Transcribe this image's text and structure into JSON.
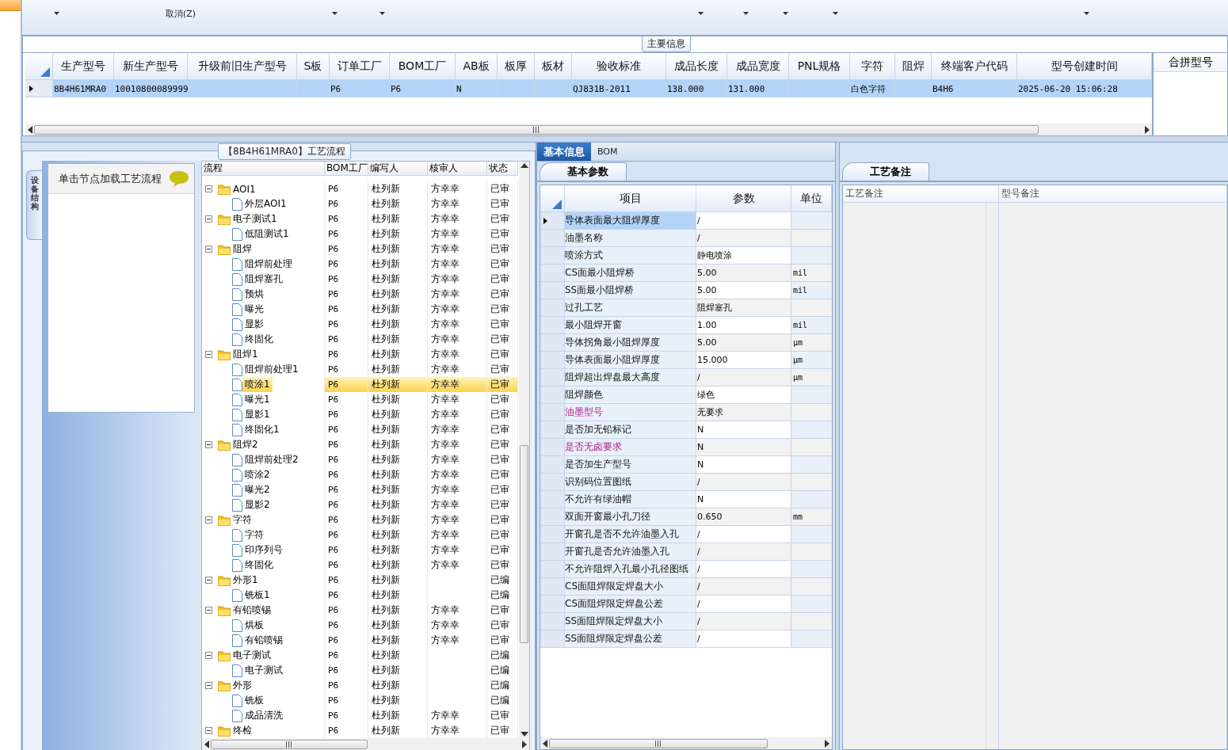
{
  "ribbon": {
    "buttons": [
      "取消(Z)"
    ]
  },
  "main_info": {
    "title": "主要信息",
    "columns": [
      "生产型号",
      "新生产型号",
      "升级前旧生产型号",
      "S板",
      "订单工厂",
      "BOM工厂",
      "AB板",
      "板厚",
      "板材",
      "验收标准",
      "成品长度",
      "成品宽度",
      "PNL规格",
      "字符",
      "阻焊",
      "终端客户代码",
      "型号创建时间"
    ],
    "rows": [
      {
        "selected": true,
        "cells": [
          "8B4H61MRA0",
          "10010800089999",
          null,
          null,
          "P6",
          "P6",
          "N",
          null,
          null,
          "QJ831B-2011",
          "138.000",
          "131.000",
          null,
          "白色字符",
          null,
          "B4H6",
          "2025-06-20 15:06:28"
        ]
      }
    ],
    "side_column": "合拼型号"
  },
  "flow": {
    "title": "【8B4H61MRA0】工艺流程",
    "side_tab": "设备结构",
    "hint": "单击节点加载工艺流程",
    "columns": [
      "流程",
      "BOM工厂",
      "编写人",
      "核审人",
      "状态"
    ],
    "nodes": [
      {
        "kind": "folder",
        "expanded": true,
        "name": "AOI1",
        "factory": "P6",
        "writer": "杜列新",
        "reviewer": "方幸幸",
        "status": "已审",
        "selected": false,
        "children": [
          {
            "kind": "file",
            "name": "外层AOI1",
            "factory": "P6",
            "writer": "杜列新",
            "reviewer": "方幸幸",
            "status": "已审",
            "selected": false
          }
        ]
      },
      {
        "kind": "folder",
        "expanded": true,
        "name": "电子测试1",
        "factory": "P6",
        "writer": "杜列新",
        "reviewer": "方幸幸",
        "status": "已审",
        "selected": false,
        "children": [
          {
            "kind": "file",
            "name": "低阻测试1",
            "factory": "P6",
            "writer": "杜列新",
            "reviewer": "方幸幸",
            "status": "已审",
            "selected": false
          }
        ]
      },
      {
        "kind": "folder",
        "expanded": true,
        "name": "阻焊",
        "factory": "P6",
        "writer": "杜列新",
        "reviewer": "方幸幸",
        "status": "已审",
        "selected": false,
        "children": [
          {
            "kind": "file",
            "name": "阻焊前处理",
            "factory": "P6",
            "writer": "杜列新",
            "reviewer": "方幸幸",
            "status": "已审",
            "selected": false
          },
          {
            "kind": "file",
            "name": "阻焊塞孔",
            "factory": "P6",
            "writer": "杜列新",
            "reviewer": "方幸幸",
            "status": "已审",
            "selected": false
          },
          {
            "kind": "file",
            "name": "预烘",
            "factory": "P6",
            "writer": "杜列新",
            "reviewer": "方幸幸",
            "status": "已审",
            "selected": false
          },
          {
            "kind": "file",
            "name": "曝光",
            "factory": "P6",
            "writer": "杜列新",
            "reviewer": "方幸幸",
            "status": "已审",
            "selected": false
          },
          {
            "kind": "file",
            "name": "显影",
            "factory": "P6",
            "writer": "杜列新",
            "reviewer": "方幸幸",
            "status": "已审",
            "selected": false
          },
          {
            "kind": "file",
            "name": "终固化",
            "factory": "P6",
            "writer": "杜列新",
            "reviewer": "方幸幸",
            "status": "已审",
            "selected": false
          }
        ]
      },
      {
        "kind": "folder",
        "expanded": true,
        "name": "阻焊1",
        "factory": "P6",
        "writer": "杜列新",
        "reviewer": "方幸幸",
        "status": "已审",
        "selected": false,
        "children": [
          {
            "kind": "file",
            "name": "阻焊前处理1",
            "factory": "P6",
            "writer": "杜列新",
            "reviewer": "方幸幸",
            "status": "已审",
            "selected": false
          },
          {
            "kind": "file",
            "name": "喷涂1",
            "factory": "P6",
            "writer": "杜列新",
            "reviewer": "方幸幸",
            "status": "已审",
            "selected": true
          },
          {
            "kind": "file",
            "name": "曝光1",
            "factory": "P6",
            "writer": "杜列新",
            "reviewer": "方幸幸",
            "status": "已审",
            "selected": false
          },
          {
            "kind": "file",
            "name": "显影1",
            "factory": "P6",
            "writer": "杜列新",
            "reviewer": "方幸幸",
            "status": "已审",
            "selected": false
          },
          {
            "kind": "file",
            "name": "终固化1",
            "factory": "P6",
            "writer": "杜列新",
            "reviewer": "方幸幸",
            "status": "已审",
            "selected": false
          }
        ]
      },
      {
        "kind": "folder",
        "expanded": true,
        "name": "阻焊2",
        "factory": "P6",
        "writer": "杜列新",
        "reviewer": "方幸幸",
        "status": "已审",
        "selected": false,
        "children": [
          {
            "kind": "file",
            "name": "阻焊前处理2",
            "factory": "P6",
            "writer": "杜列新",
            "reviewer": "方幸幸",
            "status": "已审",
            "selected": false
          },
          {
            "kind": "file",
            "name": "喷涂2",
            "factory": "P6",
            "writer": "杜列新",
            "reviewer": "方幸幸",
            "status": "已审",
            "selected": false
          },
          {
            "kind": "file",
            "name": "曝光2",
            "factory": "P6",
            "writer": "杜列新",
            "reviewer": "方幸幸",
            "status": "已审",
            "selected": false
          },
          {
            "kind": "file",
            "name": "显影2",
            "factory": "P6",
            "writer": "杜列新",
            "reviewer": "方幸幸",
            "status": "已审",
            "selected": false
          }
        ]
      },
      {
        "kind": "folder",
        "expanded": true,
        "name": "字符",
        "factory": "P6",
        "writer": "杜列新",
        "reviewer": "方幸幸",
        "status": "已审",
        "selected": false,
        "children": [
          {
            "kind": "file",
            "name": "字符",
            "factory": "P6",
            "writer": "杜列新",
            "reviewer": "方幸幸",
            "status": "已审",
            "selected": false
          },
          {
            "kind": "file",
            "name": "印序列号",
            "factory": "P6",
            "writer": "杜列新",
            "reviewer": "方幸幸",
            "status": "已审",
            "selected": false
          },
          {
            "kind": "file",
            "name": "终固化",
            "factory": "P6",
            "writer": "杜列新",
            "reviewer": "方幸幸",
            "status": "已审",
            "selected": false
          }
        ]
      },
      {
        "kind": "folder",
        "expanded": true,
        "name": "外形1",
        "factory": "P6",
        "writer": "杜列新",
        "status": "已编",
        "selected": false,
        "children": [
          {
            "kind": "file",
            "name": "铣板1",
            "factory": "P6",
            "writer": "杜列新",
            "status": "已编",
            "selected": false
          }
        ]
      },
      {
        "kind": "folder",
        "expanded": true,
        "name": "有铅喷锡",
        "factory": "P6",
        "writer": "杜列新",
        "reviewer": "方幸幸",
        "status": "已审",
        "selected": false,
        "children": [
          {
            "kind": "file",
            "name": "烘板",
            "factory": "P6",
            "writer": "杜列新",
            "reviewer": "方幸幸",
            "status": "已审",
            "selected": false
          },
          {
            "kind": "file",
            "name": "有铅喷锡",
            "factory": "P6",
            "writer": "杜列新",
            "reviewer": "方幸幸",
            "status": "已审",
            "selected": false
          }
        ]
      },
      {
        "kind": "folder",
        "expanded": true,
        "name": "电子测试",
        "factory": "P6",
        "writer": "杜列新",
        "status": "已编",
        "selected": false,
        "children": [
          {
            "kind": "file",
            "name": "电子测试",
            "factory": "P6",
            "writer": "杜列新",
            "status": "已编",
            "selected": false
          }
        ]
      },
      {
        "kind": "folder",
        "expanded": true,
        "name": "外形",
        "factory": "P6",
        "writer": "杜列新",
        "status": "已编",
        "selected": false,
        "children": [
          {
            "kind": "file",
            "name": "铣板",
            "factory": "P6",
            "writer": "杜列新",
            "status": "已编",
            "selected": false
          },
          {
            "kind": "file",
            "name": "成品清洗",
            "factory": "P6",
            "writer": "杜列新",
            "reviewer": "方幸幸",
            "status": "已审",
            "selected": false
          }
        ]
      },
      {
        "kind": "folder",
        "expanded": true,
        "name": "终检",
        "factory": "P6",
        "writer": "杜列新",
        "reviewer": "方幸幸",
        "status": "已审",
        "selected": false
      }
    ]
  },
  "details": {
    "tabs": [
      {
        "label": "基本信息",
        "selected": true
      },
      {
        "label": "BOM",
        "selected": false
      }
    ],
    "subtab": "基本参数",
    "columns": [
      "项目",
      "参数",
      "单位"
    ],
    "rows": [
      {
        "item": "导体表面最大阻焊厚度",
        "value": "/",
        "flagged": false,
        "selected": true
      },
      {
        "item": "油墨名称",
        "value": "/",
        "flagged": false,
        "selected": false
      },
      {
        "item": "喷涂方式",
        "value": "静电喷涂",
        "flagged": false,
        "selected": false
      },
      {
        "item": "CS面最小阻焊桥",
        "value": "5.00",
        "unit": "mil",
        "flagged": false,
        "selected": false
      },
      {
        "item": "SS面最小阻焊桥",
        "value": "5.00",
        "unit": "mil",
        "flagged": false,
        "selected": false
      },
      {
        "item": "过孔工艺",
        "value": "阻焊塞孔",
        "flagged": false,
        "selected": false
      },
      {
        "item": "最小阻焊开窗",
        "value": "1.00",
        "unit": "mil",
        "flagged": false,
        "selected": false
      },
      {
        "item": "导体拐角最小阻焊厚度",
        "value": "5.00",
        "unit": "μm",
        "flagged": false,
        "selected": false
      },
      {
        "item": "导体表面最小阻焊厚度",
        "value": "15.000",
        "unit": "μm",
        "flagged": false,
        "selected": false
      },
      {
        "item": "阻焊超出焊盘最大高度",
        "value": "/",
        "unit": "μm",
        "flagged": false,
        "selected": false
      },
      {
        "item": "阻焊颜色",
        "value": "绿色",
        "flagged": false,
        "selected": false
      },
      {
        "item": "油墨型号",
        "value": "无要求",
        "flagged": true,
        "selected": false
      },
      {
        "item": "是否加无铅标记",
        "value": "N",
        "flagged": false,
        "selected": false
      },
      {
        "item": "是否无卤要求",
        "value": "N",
        "flagged": true,
        "selected": false
      },
      {
        "item": "是否加生产型号",
        "value": "N",
        "flagged": false,
        "selected": false
      },
      {
        "item": "识别码位置图纸",
        "value": "/",
        "flagged": false,
        "selected": false
      },
      {
        "item": "不允许有绿油帽",
        "value": "N",
        "flagged": false,
        "selected": false
      },
      {
        "item": "双面开窗最小孔刀径",
        "value": "0.650",
        "unit": "mm",
        "flagged": false,
        "selected": false
      },
      {
        "item": "开窗孔是否不允许油墨入孔",
        "value": "/",
        "flagged": false,
        "selected": false
      },
      {
        "item": "开窗孔是否允许油墨入孔",
        "value": "/",
        "flagged": false,
        "selected": false
      },
      {
        "item": "不允许阻焊入孔最小孔径图纸",
        "value": "/",
        "flagged": false,
        "selected": false
      },
      {
        "item": "CS面阻焊限定焊盘大小",
        "value": "/",
        "flagged": false,
        "selected": false
      },
      {
        "item": "CS面阻焊限定焊盘公差",
        "value": "/",
        "flagged": false,
        "selected": false
      },
      {
        "item": "SS面阻焊限定焊盘大小",
        "value": "/",
        "flagged": false,
        "selected": false
      },
      {
        "item": "SS面阻焊限定焊盘公差",
        "value": "/",
        "flagged": false,
        "selected": false
      }
    ]
  },
  "notes": {
    "tab": "工艺备注",
    "columns": [
      "工艺备注",
      "型号备注"
    ]
  }
}
